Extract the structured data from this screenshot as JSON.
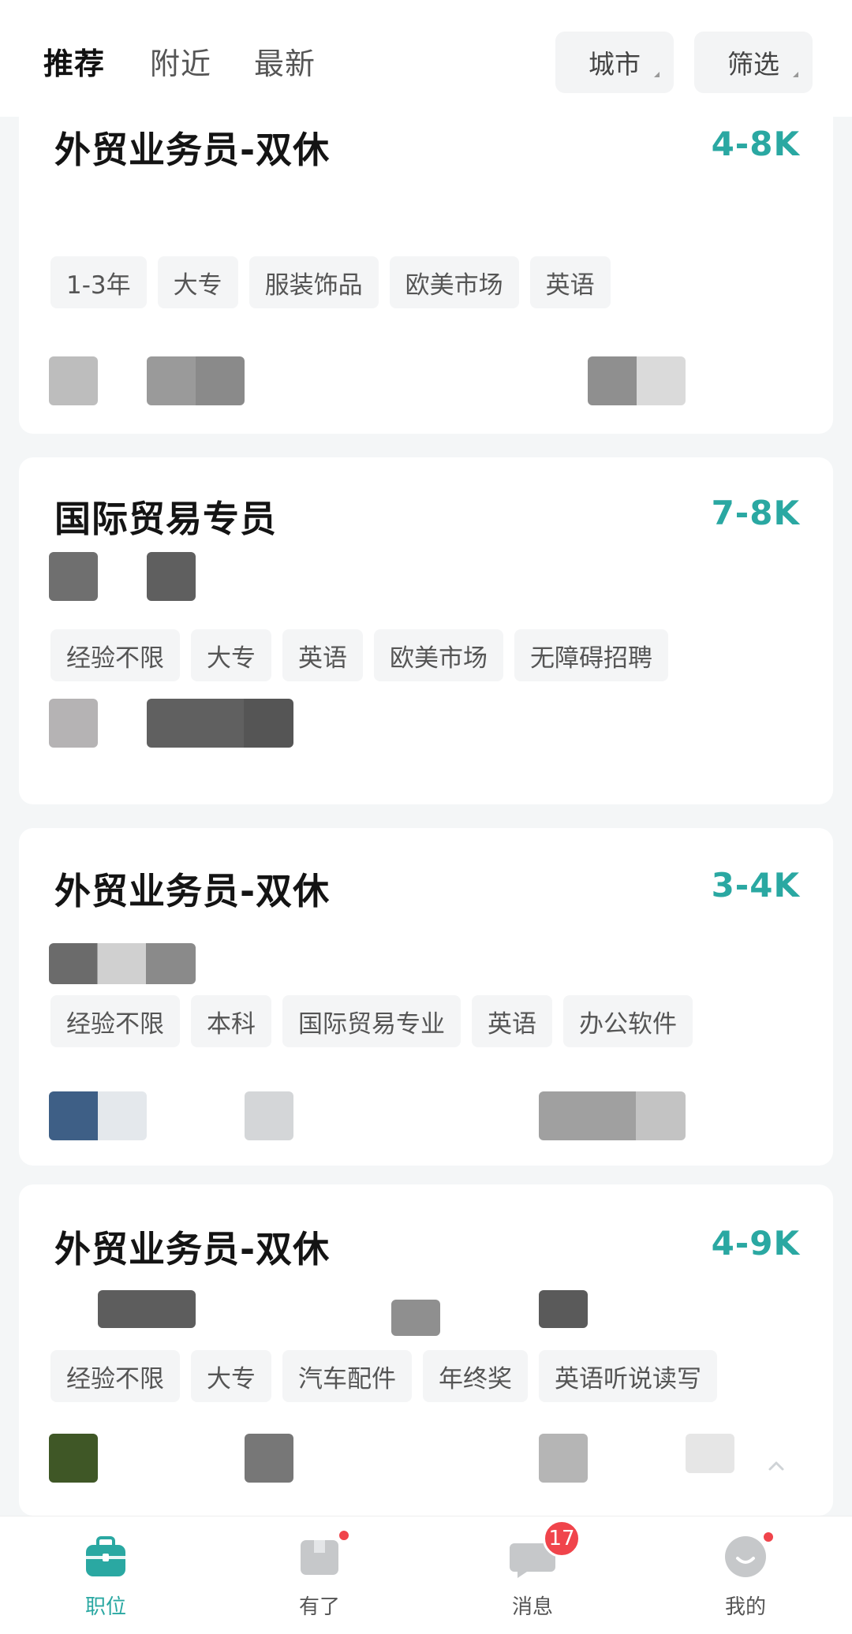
{
  "header": {
    "tabs": [
      {
        "label": "推荐",
        "active": true
      },
      {
        "label": "附近",
        "active": false
      },
      {
        "label": "最新",
        "active": false
      }
    ],
    "city_label": "城市",
    "filter_label": "筛选"
  },
  "jobs": [
    {
      "title": "外贸业务员-双休",
      "salary": "4-8K",
      "tags": [
        "1-3年",
        "大专",
        "服装饰品",
        "欧美市场",
        "英语"
      ]
    },
    {
      "title": "国际贸易专员",
      "salary": "7-8K",
      "tags": [
        "经验不限",
        "大专",
        "英语",
        "欧美市场",
        "无障碍招聘"
      ]
    },
    {
      "title": "外贸业务员-双休",
      "salary": "3-4K",
      "tags": [
        "经验不限",
        "本科",
        "国际贸易专业",
        "英语",
        "办公软件"
      ]
    },
    {
      "title": "外贸业务员-双休",
      "salary": "4-9K",
      "tags": [
        "经验不限",
        "大专",
        "汽车配件",
        "年终奖",
        "英语听说读写"
      ]
    }
  ],
  "bottom_nav": {
    "items": [
      {
        "label": "职位",
        "icon": "briefcase-icon",
        "active": true
      },
      {
        "label": "有了",
        "icon": "box-icon",
        "dot": true
      },
      {
        "label": "消息",
        "icon": "chat-icon",
        "badge": "17"
      },
      {
        "label": "我的",
        "icon": "smiley-icon",
        "dot": true
      }
    ]
  },
  "colors": {
    "accent": "#2aa8a2",
    "badge": "#f0444b"
  }
}
